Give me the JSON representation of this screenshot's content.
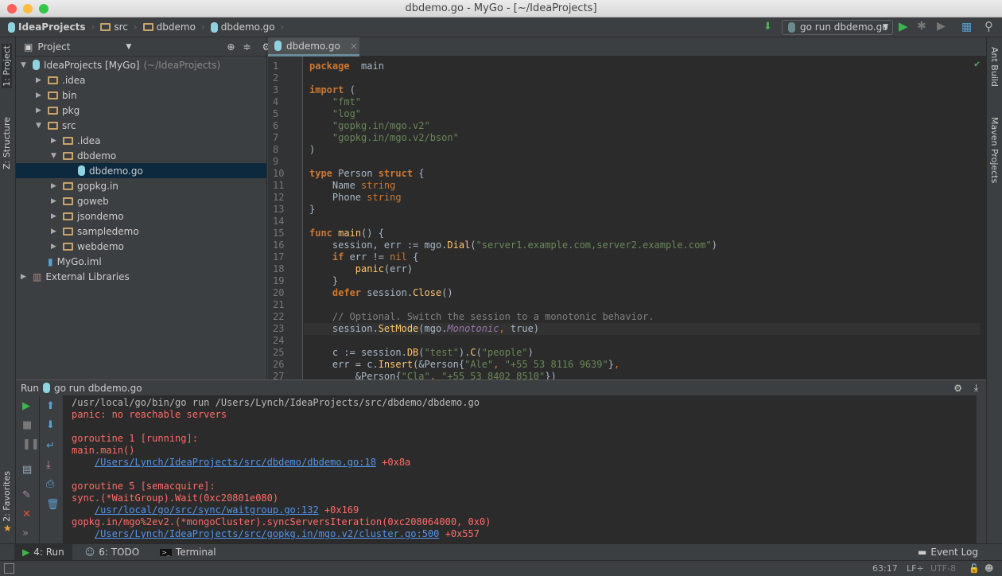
{
  "window": {
    "title": "dbdemo.go - MyGo - [~/IdeaProjects]"
  },
  "breadcrumb": [
    "IdeaProjects",
    "src",
    "dbdemo",
    "dbdemo.go"
  ],
  "toolbar": {
    "run_config": "go run dbdemo.go"
  },
  "left_stripe": {
    "project": "1: Project",
    "structure": "Z: Structure",
    "favorites": "2: Favorites"
  },
  "right_stripe": {
    "ant": "Ant Build",
    "maven": "Maven Projects"
  },
  "project": {
    "header": "Project",
    "tree": [
      {
        "label": "IdeaProjects [MyGo]",
        "suffix": "(~/IdeaProjects)",
        "depth": 0,
        "icon": "module",
        "arrow": "▼"
      },
      {
        "label": ".idea",
        "depth": 1,
        "icon": "folder",
        "arrow": "▶"
      },
      {
        "label": "bin",
        "depth": 1,
        "icon": "folder",
        "arrow": "▶"
      },
      {
        "label": "pkg",
        "depth": 1,
        "icon": "folder",
        "arrow": "▶"
      },
      {
        "label": "src",
        "depth": 1,
        "icon": "folder",
        "arrow": "▼"
      },
      {
        "label": ".idea",
        "depth": 2,
        "icon": "folder",
        "arrow": "▶"
      },
      {
        "label": "dbdemo",
        "depth": 2,
        "icon": "folder",
        "arrow": "▼"
      },
      {
        "label": "dbdemo.go",
        "depth": 3,
        "icon": "gofile",
        "arrow": "",
        "selected": true
      },
      {
        "label": "gopkg.in",
        "depth": 2,
        "icon": "folder",
        "arrow": "▶"
      },
      {
        "label": "goweb",
        "depth": 2,
        "icon": "folder",
        "arrow": "▶"
      },
      {
        "label": "jsondemo",
        "depth": 2,
        "icon": "folder",
        "arrow": "▶"
      },
      {
        "label": "sampledemo",
        "depth": 2,
        "icon": "folder",
        "arrow": "▶"
      },
      {
        "label": "webdemo",
        "depth": 2,
        "icon": "folder",
        "arrow": "▶"
      },
      {
        "label": "MyGo.iml",
        "depth": 1,
        "icon": "iml",
        "arrow": ""
      },
      {
        "label": "External Libraries",
        "depth": 0,
        "icon": "library",
        "arrow": "▶"
      }
    ]
  },
  "editor": {
    "tab": "dbdemo.go",
    "current_line": 23,
    "lines": [
      [
        [
          "k",
          "package"
        ],
        [
          "",
          "  main"
        ]
      ],
      [],
      [
        [
          "k",
          "import"
        ],
        [
          "",
          " ("
        ]
      ],
      [
        [
          "s",
          "    \"fmt\""
        ]
      ],
      [
        [
          "s",
          "    \"log\""
        ]
      ],
      [
        [
          "s",
          "    \"gopkg.in/mgo.v2\""
        ]
      ],
      [
        [
          "s",
          "    \"gopkg.in/mgo.v2/bson\""
        ]
      ],
      [
        [
          "",
          ")"
        ]
      ],
      [],
      [
        [
          "k",
          "type"
        ],
        [
          "",
          " Person "
        ],
        [
          "k",
          "struct"
        ],
        [
          "",
          " {"
        ]
      ],
      [
        [
          "",
          "    Name "
        ],
        [
          "t",
          "string"
        ]
      ],
      [
        [
          "",
          "    Phone "
        ],
        [
          "t",
          "string"
        ]
      ],
      [
        [
          "",
          "}"
        ]
      ],
      [],
      [
        [
          "k",
          "func"
        ],
        [
          "",
          " "
        ],
        [
          "f",
          "main"
        ],
        [
          "",
          "() {"
        ]
      ],
      [
        [
          "",
          "    session, err := mgo."
        ],
        [
          "f",
          "Dial"
        ],
        [
          "",
          "("
        ],
        [
          "s",
          "\"server1.example.com,server2.example.com\""
        ],
        [
          "",
          ")"
        ]
      ],
      [
        [
          "",
          "    "
        ],
        [
          "k",
          "if"
        ],
        [
          "",
          " err != "
        ],
        [
          "t",
          "nil"
        ],
        [
          "",
          " {"
        ]
      ],
      [
        [
          "",
          "        "
        ],
        [
          "f",
          "panic"
        ],
        [
          "",
          "(err)"
        ]
      ],
      [
        [
          "",
          "    }"
        ]
      ],
      [
        [
          "",
          "    "
        ],
        [
          "k",
          "defer"
        ],
        [
          "",
          " session."
        ],
        [
          "f",
          "Close"
        ],
        [
          "",
          "()"
        ]
      ],
      [],
      [
        [
          "c",
          "    // Optional. Switch the session to a monotonic behavior."
        ]
      ],
      [
        [
          "",
          "    session."
        ],
        [
          "f",
          "SetMode"
        ],
        [
          "",
          "(mgo."
        ],
        [
          "i",
          "Monotonic"
        ],
        [
          "t",
          ","
        ],
        [
          "",
          " true)"
        ]
      ],
      [],
      [
        [
          "",
          "    c := session."
        ],
        [
          "f",
          "DB"
        ],
        [
          "",
          "("
        ],
        [
          "s",
          "\"test\""
        ],
        [
          "",
          ")."
        ],
        [
          "f",
          "C"
        ],
        [
          "",
          "("
        ],
        [
          "s",
          "\"people\""
        ],
        [
          "",
          ")"
        ]
      ],
      [
        [
          "",
          "    err = c."
        ],
        [
          "f",
          "Insert"
        ],
        [
          "",
          "(&Person{"
        ],
        [
          "s",
          "\"Ale\""
        ],
        [
          "t",
          ","
        ],
        [
          "",
          " "
        ],
        [
          "s",
          "\"+55 53 8116 9639\""
        ],
        [
          "",
          "}"
        ],
        [
          "t",
          ","
        ]
      ],
      [
        [
          "",
          "        &Person{"
        ],
        [
          "s",
          "\"Cla\""
        ],
        [
          "t",
          ","
        ],
        [
          "",
          " "
        ],
        [
          "s",
          "\"+55 53 8402 8510\""
        ],
        [
          "",
          "})"
        ]
      ]
    ]
  },
  "run": {
    "header": "Run",
    "config": "go run dbdemo.go",
    "output": [
      {
        "type": "cmd",
        "text": "/usr/local/go/bin/go run /Users/Lynch/IdeaProjects/src/dbdemo/dbdemo.go"
      },
      {
        "type": "err",
        "text": "panic: no reachable servers"
      },
      {
        "type": "err",
        "text": ""
      },
      {
        "type": "err",
        "text": "goroutine 1 [running]:"
      },
      {
        "type": "err",
        "text": "main.main()"
      },
      {
        "type": "link",
        "link": "/Users/Lynch/IdeaProjects/src/dbdemo/dbdemo.go:18",
        "suffix": " +0x8a"
      },
      {
        "type": "err",
        "text": ""
      },
      {
        "type": "err",
        "text": "goroutine 5 [semacquire]:"
      },
      {
        "type": "err",
        "text": "sync.(*WaitGroup).Wait(0xc20801e080)"
      },
      {
        "type": "link",
        "link": "/usr/local/go/src/sync/waitgroup.go:132",
        "suffix": " +0x169"
      },
      {
        "type": "err",
        "text": "gopkg.in/mgo%2ev2.(*mongoCluster).syncServersIteration(0xc208064000, 0x0)"
      },
      {
        "type": "link",
        "link": "/Users/Lynch/IdeaProjects/src/gopkg.in/mgo.v2/cluster.go:500",
        "suffix": " +0x557"
      }
    ]
  },
  "bottom_tabs": [
    {
      "label": "4: Run",
      "active": true
    },
    {
      "label": "6: TODO"
    },
    {
      "label": "Terminal"
    }
  ],
  "event_log": "Event Log",
  "status": {
    "position": "63:17",
    "line_sep": "LF÷",
    "encoding": "UTF-8"
  }
}
